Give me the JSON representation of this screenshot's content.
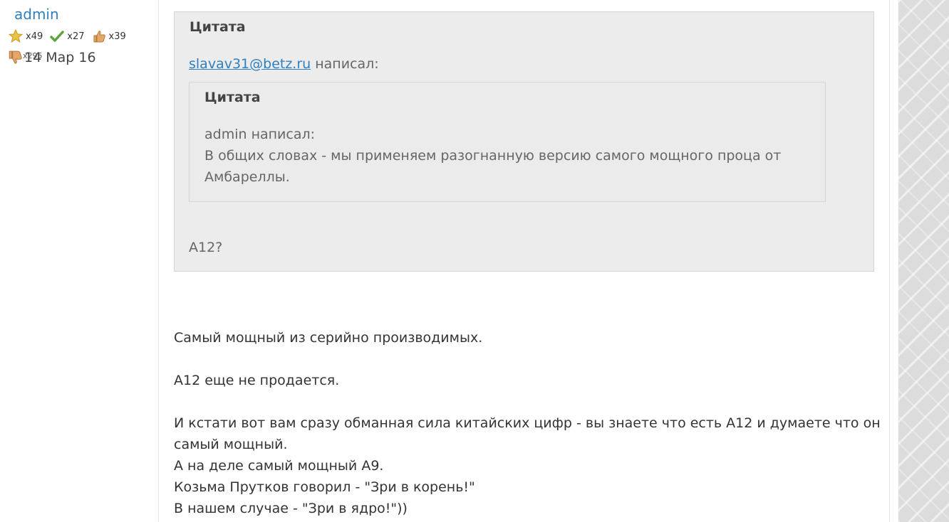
{
  "author": {
    "name": "admin",
    "awards": [
      {
        "icon": "star-medal-icon",
        "count": "x49",
        "color": "#e3b21c"
      },
      {
        "icon": "checkmark-icon",
        "count": "x27",
        "color": "#5aa63a"
      },
      {
        "icon": "thumbs-up-icon",
        "count": "x39",
        "color": "#e0a060"
      }
    ],
    "thumbs_down_count": "x295",
    "date": "14 Мар 16"
  },
  "post": {
    "outer_quote": {
      "title": "Цитата",
      "author_link": "slavav31@betz.ru",
      "author_suffix": " написал:",
      "inner_quote": {
        "title": "Цитата",
        "author_line": "admin написал:",
        "line1": "В общих словах - мы применяем разогнанную версию самого мощного проца от",
        "line2": "Амбареллы."
      },
      "reply": "A12?"
    },
    "body": [
      "Самый мощный из серийно производимых.",
      "A12 еще не продается.",
      "И кстати вот вам сразу обманная сила китайских цифр - вы знаете что есть A12 и думаете что он",
      "самый мощный.",
      "А на деле самый мощный A9.",
      "Козьма Прутков говорил - \"Зри в корень!\"",
      "В нашем случае - \"Зри в ядро!\"))"
    ]
  },
  "colors": {
    "link": "#2f7fbf",
    "quote_bg": "#ececec"
  }
}
